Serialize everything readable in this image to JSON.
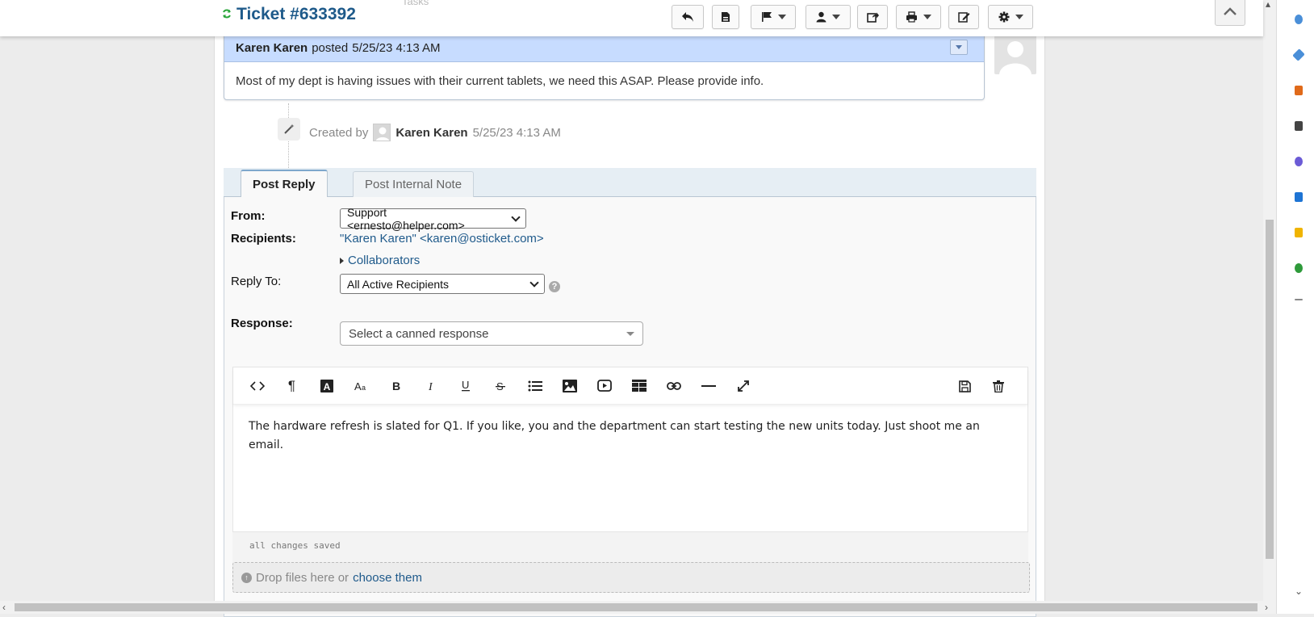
{
  "header": {
    "ghost_text": "Tasks",
    "ticket_title": "Ticket #633392"
  },
  "entry": {
    "author": "Karen Karen",
    "posted_label": "posted",
    "timestamp": "5/25/23 4:13 AM",
    "body": "Most of my dept is having issues with their current tablets, we need this ASAP. Please provide info."
  },
  "event": {
    "created_by_label": "Created by",
    "user": "Karen Karen",
    "timestamp": "5/25/23 4:13 AM"
  },
  "tabs": [
    {
      "label": "Post Reply",
      "active": true
    },
    {
      "label": "Post Internal Note",
      "active": false
    }
  ],
  "form": {
    "from_label": "From:",
    "from_value": "Support <ernesto@helper.com>",
    "recipients_label": "Recipients:",
    "recipients_value": "\"Karen Karen\" <karen@osticket.com>",
    "collaborators_label": "Collaborators",
    "reply_to_label": "Reply To:",
    "reply_to_value": "All Active Recipients",
    "response_label": "Response:",
    "canned_placeholder": "Select a canned response"
  },
  "editor": {
    "toolbar": [
      "code-icon",
      "paragraph-icon",
      "text-color-icon",
      "font-size-icon",
      "bold-icon",
      "italic-icon",
      "underline-icon",
      "strikethrough-icon",
      "list-icon",
      "image-icon",
      "video-icon",
      "table-icon",
      "link-icon",
      "horizontal-rule-icon",
      "fullscreen-icon"
    ],
    "toolbar_right": [
      "save-draft-icon",
      "delete-draft-icon"
    ],
    "body": "The hardware refresh is slated for Q1. If you like, you and the department can start testing the new units today. Just shoot me an email.",
    "status": "all changes saved"
  },
  "dropzone": {
    "text": "Drop files here or",
    "link": "choose them"
  }
}
